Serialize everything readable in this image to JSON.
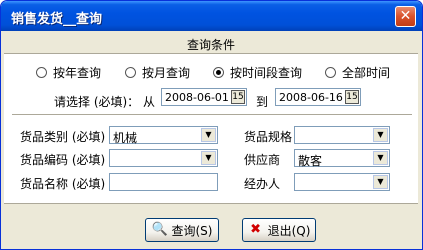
{
  "window": {
    "title": "销售发货__查询",
    "close_glyph": "✕"
  },
  "header": {
    "title": "查询条件"
  },
  "period": {
    "options": [
      {
        "label": "按年查询",
        "selected": false
      },
      {
        "label": "按月查询",
        "selected": false
      },
      {
        "label": "按时间段查询",
        "selected": true
      },
      {
        "label": "全部时间",
        "selected": false
      }
    ]
  },
  "dates": {
    "prompt": "请选择 (必填)： 从",
    "from": "2008-06-01",
    "to_label": "到",
    "to": "2008-06-16",
    "calendar_glyph": "15"
  },
  "form": {
    "category": {
      "label": "货品类别 (必填)",
      "value": "机械"
    },
    "code": {
      "label": "货品编码 (必填)",
      "value": ""
    },
    "name": {
      "label": "货品名称 (必填)",
      "value": ""
    },
    "spec": {
      "label": "货品规格",
      "value": ""
    },
    "supplier": {
      "label": "供应商",
      "value": "散客"
    },
    "handler": {
      "label": "经办人",
      "value": ""
    }
  },
  "buttons": {
    "query": "查询(S)",
    "exit": "退出(Q)"
  },
  "icons": {
    "query": "search-icon",
    "exit": "close-icon"
  }
}
